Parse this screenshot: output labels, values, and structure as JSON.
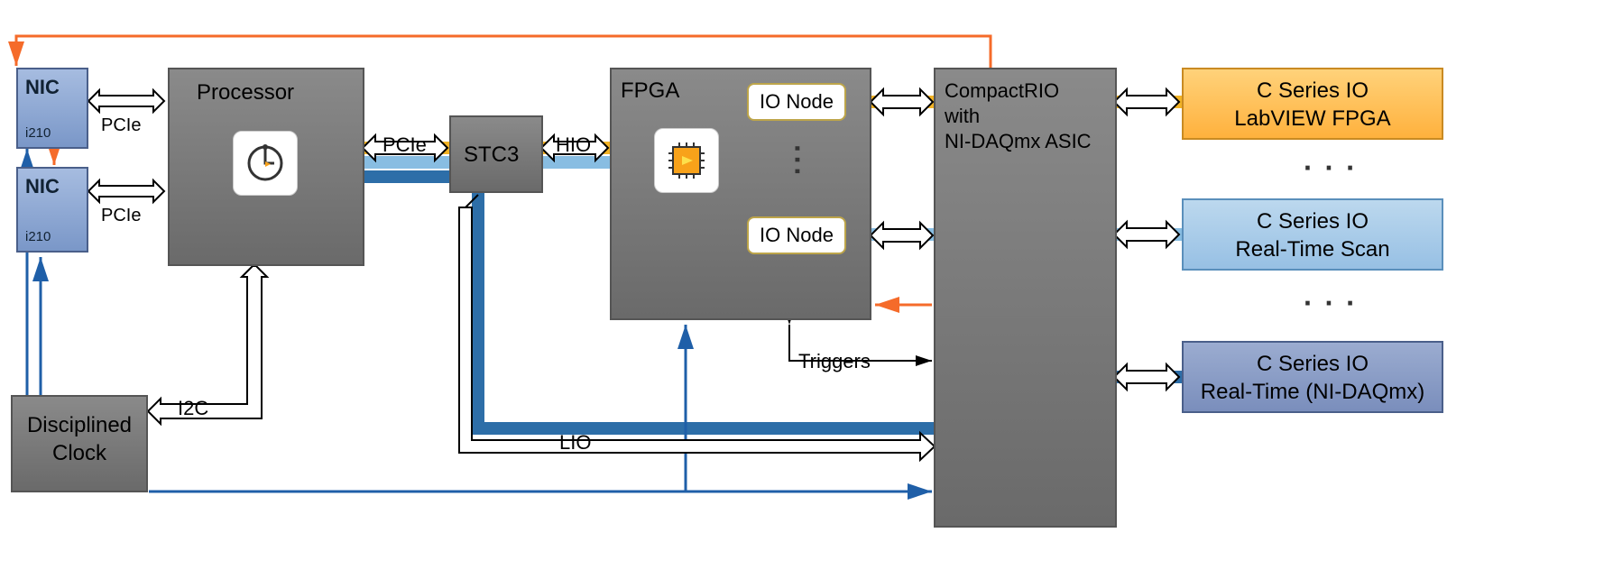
{
  "blocks": {
    "nic1": "NIC",
    "nic1b": "i210",
    "nic2": "NIC",
    "nic2b": "i210",
    "proc": "Processor",
    "stc3": "STC3",
    "fpga": "FPGA",
    "crio_l1": "CompactRIO",
    "crio_l2": "with",
    "crio_l3": "NI-DAQmx ASIC",
    "ionode1": "IO Node",
    "ionode2": "IO Node",
    "clock_l1": "Disciplined",
    "clock_l2": "Clock",
    "cs1_l1": "C Series IO",
    "cs1_l2": "LabVIEW FPGA",
    "cs2_l1": "C Series IO",
    "cs2_l2": "Real-Time Scan",
    "cs3_l1": "C Series IO",
    "cs3_l2": "Real-Time (NI-DAQmx)"
  },
  "labels": {
    "pcie": "PCIe",
    "i2c": "I2C",
    "hio": "HIO",
    "lio": "LIO",
    "triggers": "Triggers"
  },
  "chart_data": {
    "type": "diagram",
    "nodes": [
      {
        "id": "nic1",
        "label": "NIC i210"
      },
      {
        "id": "nic2",
        "label": "NIC i210"
      },
      {
        "id": "proc",
        "label": "Processor"
      },
      {
        "id": "stc3",
        "label": "STC3"
      },
      {
        "id": "fpga",
        "label": "FPGA",
        "subnodes": [
          "IO Node",
          "IO Node"
        ]
      },
      {
        "id": "crio",
        "label": "CompactRIO with NI-DAQmx ASIC"
      },
      {
        "id": "clock",
        "label": "Disciplined Clock"
      },
      {
        "id": "cs1",
        "label": "C Series IO LabVIEW FPGA"
      },
      {
        "id": "cs2",
        "label": "C Series IO Real-Time Scan"
      },
      {
        "id": "cs3",
        "label": "C Series IO Real-Time (NI-DAQmx)"
      }
    ],
    "edges": [
      {
        "from": "nic1",
        "to": "proc",
        "label": "PCIe"
      },
      {
        "from": "nic2",
        "to": "proc",
        "label": "PCIe"
      },
      {
        "from": "proc",
        "to": "stc3",
        "label": "PCIe"
      },
      {
        "from": "stc3",
        "to": "fpga",
        "label": "HIO"
      },
      {
        "from": "fpga",
        "to": "crio"
      },
      {
        "from": "crio",
        "to": "cs1"
      },
      {
        "from": "crio",
        "to": "cs2"
      },
      {
        "from": "crio",
        "to": "cs3"
      },
      {
        "from": "proc",
        "to": "clock",
        "label": "I2C"
      },
      {
        "from": "stc3",
        "to": "crio",
        "label": "LIO"
      },
      {
        "from": "fpga",
        "to": "crio",
        "label": "Triggers"
      },
      {
        "from": "clock",
        "to": "nic1",
        "color": "blue"
      },
      {
        "from": "clock",
        "to": "nic2",
        "color": "blue"
      },
      {
        "from": "clock",
        "to": "fpga",
        "color": "blue"
      },
      {
        "from": "clock",
        "to": "crio",
        "color": "blue"
      },
      {
        "from": "nic1",
        "to": "nic2",
        "color": "orange"
      },
      {
        "from": "crio",
        "to": "nic1",
        "color": "orange",
        "via": "top"
      }
    ],
    "paths": [
      {
        "color": "yellow",
        "nodes": [
          "proc",
          "fpga.ionode1",
          "crio",
          "cs1"
        ]
      },
      {
        "color": "lightblue",
        "nodes": [
          "proc",
          "fpga.ionode2",
          "crio",
          "cs2"
        ]
      },
      {
        "color": "darkblue",
        "nodes": [
          "proc",
          "stc3",
          "crio",
          "cs3"
        ]
      }
    ]
  }
}
